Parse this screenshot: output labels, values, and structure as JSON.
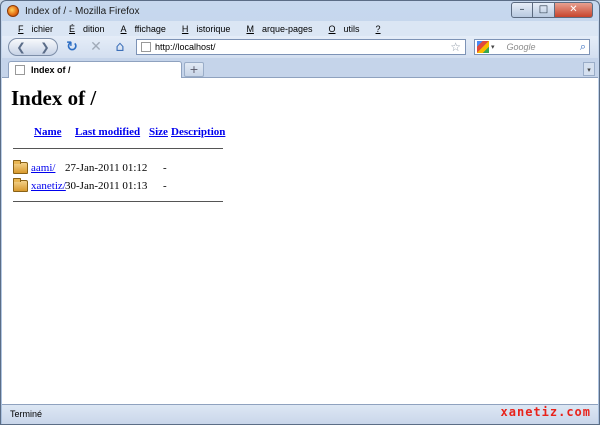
{
  "window": {
    "title": "Index of / - Mozilla Firefox"
  },
  "menu": {
    "items": [
      {
        "pre": "",
        "u": "F",
        "post": "ichier"
      },
      {
        "pre": "",
        "u": "É",
        "post": "dition"
      },
      {
        "pre": "",
        "u": "A",
        "post": "ffichage"
      },
      {
        "pre": "",
        "u": "H",
        "post": "istorique"
      },
      {
        "pre": "",
        "u": "M",
        "post": "arque-pages"
      },
      {
        "pre": "",
        "u": "O",
        "post": "utils"
      },
      {
        "pre": "",
        "u": "?",
        "post": ""
      }
    ]
  },
  "nav": {
    "url": "http://localhost/",
    "search_placeholder": "Google"
  },
  "tab": {
    "label": "Index of /"
  },
  "page": {
    "heading": "Index of /",
    "columns": {
      "name": "Name",
      "last_modified": "Last modified",
      "size": "Size",
      "description": "Description"
    },
    "rows": [
      {
        "name": "aami/",
        "date": "27-Jan-2011 01:12",
        "size": "-"
      },
      {
        "name": "xanetiz/",
        "date": "30-Jan-2011 01:13",
        "size": "-"
      }
    ]
  },
  "status": {
    "text": "Terminé"
  },
  "watermark": {
    "text": "xanetiz.com"
  },
  "icons": {
    "back": "back-arrow-icon",
    "forward": "forward-arrow-icon",
    "reload": "reload-icon",
    "stop": "stop-icon",
    "home": "home-icon",
    "bookmark": "star-icon",
    "search": "magnifier-icon"
  },
  "colors": {
    "link": "#0000ee",
    "window_frame": "#a9c0de",
    "close_button": "#c7442c"
  }
}
